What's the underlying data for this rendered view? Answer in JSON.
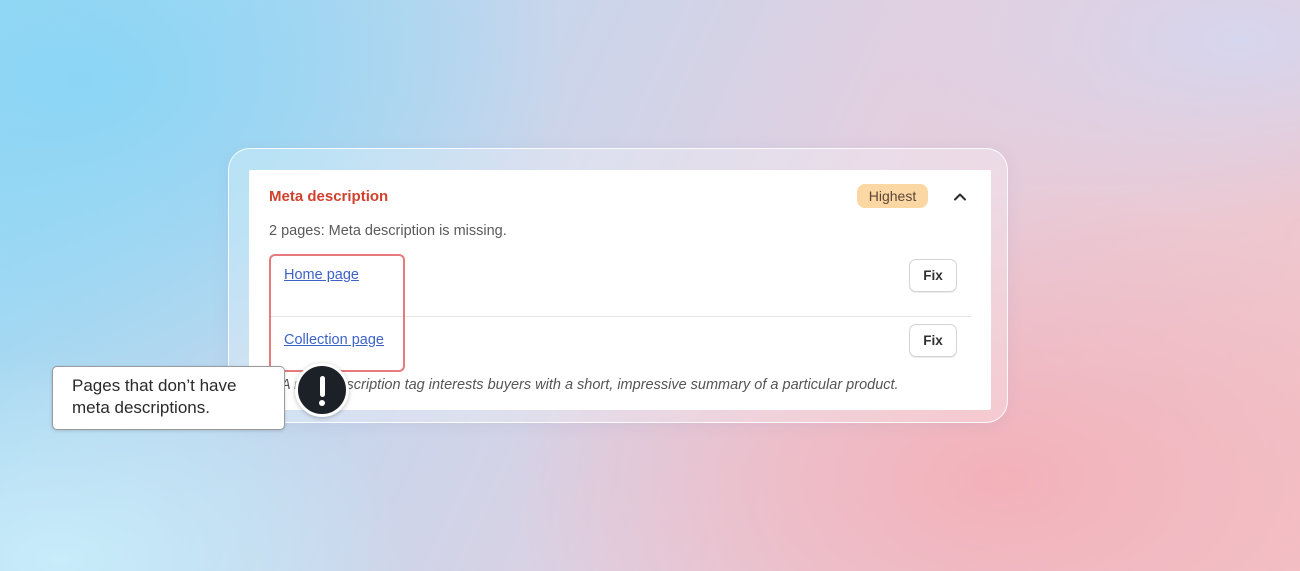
{
  "card": {
    "title": "Meta description",
    "badge": "Highest",
    "summary": "2 pages: Meta description is missing.",
    "footnote": "A meta description tag interests buyers with a short, impressive summary of a particular product.",
    "rows": [
      {
        "link": "Home page",
        "button": "Fix"
      },
      {
        "link": "Collection page",
        "button": "Fix"
      }
    ]
  },
  "callout": {
    "text": "Pages that don’t have meta descriptions."
  },
  "icons": {
    "collapse": "chevron-up-icon",
    "alert": "exclamation-icon"
  },
  "colors": {
    "title": "#d1412f",
    "badge_bg": "#fbd7a4",
    "link": "#3d63c9",
    "highlight": "#e77a7c",
    "alert_bg": "#1b2126"
  }
}
